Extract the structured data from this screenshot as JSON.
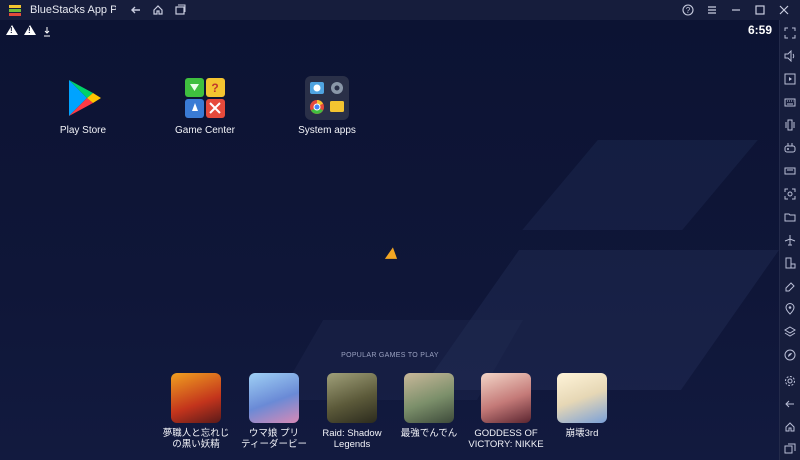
{
  "window": {
    "title": "BlueStacks App Playe"
  },
  "status": {
    "time": "6:59"
  },
  "apps": [
    {
      "label": "Play Store",
      "icon": "play-store-icon"
    },
    {
      "label": "Game Center",
      "icon": "game-center-icon"
    },
    {
      "label": "System apps",
      "icon": "system-apps-icon"
    }
  ],
  "popular": {
    "title": "POPULAR GAMES TO PLAY",
    "games": [
      {
        "label": "夢職人と忘れじ\nの黒い妖精",
        "color": "#c3341c"
      },
      {
        "label": "ウマ娘 プリ\nティーダービー",
        "color": "#6a8ad6"
      },
      {
        "label": "Raid: Shadow\nLegends",
        "color": "#5c5a3a"
      },
      {
        "label": "最強でんでん",
        "color": "#7b8f6a"
      },
      {
        "label": "GODDESS OF\nVICTORY: NIKKE",
        "color": "#c47a78"
      },
      {
        "label": "崩壊3rd",
        "color": "#e6d7b5"
      }
    ]
  },
  "sidebar": {
    "items": [
      "fullscreen-icon",
      "volume-icon",
      "media-icon",
      "keyboard-icon",
      "shake-icon",
      "gamepad-icon",
      "apk-icon",
      "screenshot-icon",
      "folder-icon",
      "airplane-icon",
      "rotate-icon",
      "erase-icon",
      "location-icon",
      "layers-icon",
      "eco-icon",
      "settings-icon",
      "back-icon",
      "home-icon",
      "recents-icon"
    ]
  },
  "colors": {
    "background": "#0d1433",
    "chrome": "#161d3c",
    "accent": "#f2a623"
  }
}
